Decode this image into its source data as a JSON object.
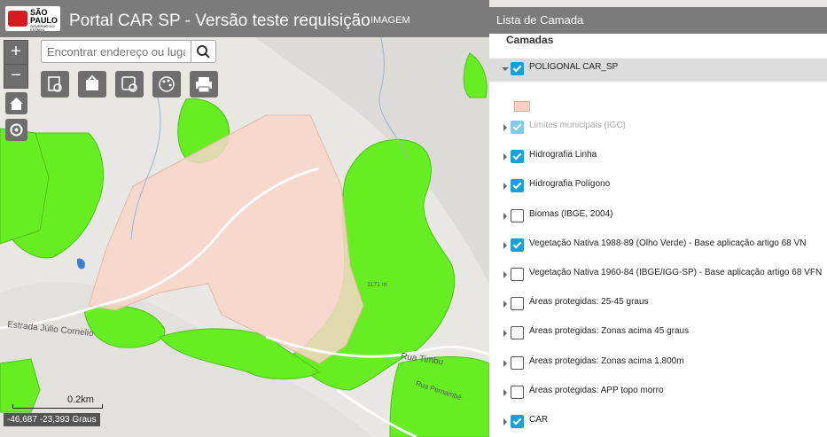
{
  "header": {
    "logo_text": "SÃO PAULO",
    "logo_subtext": "GOVERNO DO ESTADO",
    "title": "Portal CAR SP - Versão teste requisição",
    "tab_imagem": "IMAGEM"
  },
  "map": {
    "zoom_in": "+",
    "zoom_out": "−",
    "search_placeholder": "Encontrar endereço ou lugar",
    "scale_label": "0.2km",
    "coordinates": "-46,687 -23,393 Graus",
    "road_1": "Estrada Júlio Cornelio",
    "road_2": "Rua Timbu",
    "road_3": "Rua Pernambé",
    "elevation": "1171 m"
  },
  "panel": {
    "title": "Lista de Camada",
    "subtitle": "Camadas",
    "layers": [
      {
        "label": "POLIGONAL CAR_SP",
        "checked": true
      },
      {
        "label": "Limites municipais (IGC)",
        "checked": true
      },
      {
        "label": "Hidrografia Linha",
        "checked": true
      },
      {
        "label": "Hidrografia Polígono",
        "checked": true
      },
      {
        "label": "Biomas (IBGE, 2004)",
        "checked": false
      },
      {
        "label": "Vegetação Nativa 1988-89 (Olho Verde) - Base aplicação artigo 68 VN",
        "checked": true
      },
      {
        "label": "Vegetação Nativa 1960-84 (IBGE/IGG-SP) - Base aplicação artigo 68 VFN",
        "checked": false
      },
      {
        "label": "Áreas protegidas: 25-45 graus",
        "checked": false
      },
      {
        "label": "Áreas protegidas: Zonas acima 45 graus",
        "checked": false
      },
      {
        "label": "Áreas protegidas: Zonas acima 1.800m",
        "checked": false
      },
      {
        "label": "Áreas protegidas: APP topo morro",
        "checked": false
      },
      {
        "label": "CAR",
        "checked": true
      }
    ]
  },
  "colors": {
    "vegetation": "#66ee22",
    "polygon_fill": "#f8d6c8",
    "header": "#7b7b7b",
    "checkbox": "#1aa0d8"
  }
}
